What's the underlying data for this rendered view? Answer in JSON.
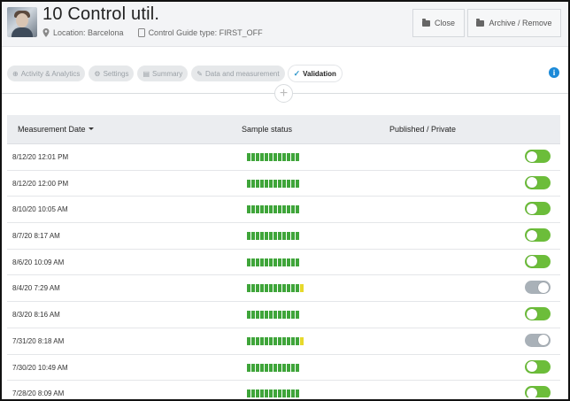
{
  "header": {
    "title": "10 Control util.",
    "location": "Location: Barcelona",
    "guide": "Control Guide type: FIRST_OFF",
    "close_label": "Close",
    "archive_label": "Archive / Remove"
  },
  "tabs": [
    {
      "label": "Activity & Analytics"
    },
    {
      "label": "Settings"
    },
    {
      "label": "Summary"
    },
    {
      "label": "Data and measurement"
    },
    {
      "label": "Validation",
      "active": true
    }
  ],
  "table": {
    "col_date": "Measurement Date",
    "col_status": "Sample status",
    "col_pub": "Published / Private",
    "rows": [
      {
        "date": "8/12/20 12:01 PM",
        "samples": [
          "g",
          "g",
          "g",
          "g",
          "g",
          "g",
          "g",
          "g",
          "g",
          "g",
          "g",
          "g"
        ],
        "published": true
      },
      {
        "date": "8/12/20 12:00 PM",
        "samples": [
          "g",
          "g",
          "g",
          "g",
          "g",
          "g",
          "g",
          "g",
          "g",
          "g",
          "g",
          "g"
        ],
        "published": true
      },
      {
        "date": "8/10/20 10:05 AM",
        "samples": [
          "g",
          "g",
          "g",
          "g",
          "g",
          "g",
          "g",
          "g",
          "g",
          "g",
          "g",
          "g"
        ],
        "published": true
      },
      {
        "date": "8/7/20 8:17 AM",
        "samples": [
          "g",
          "g",
          "g",
          "g",
          "g",
          "g",
          "g",
          "g",
          "g",
          "g",
          "g",
          "g"
        ],
        "published": true
      },
      {
        "date": "8/6/20 10:09 AM",
        "samples": [
          "g",
          "g",
          "g",
          "g",
          "g",
          "g",
          "g",
          "g",
          "g",
          "g",
          "g",
          "g"
        ],
        "published": true
      },
      {
        "date": "8/4/20 7:29 AM",
        "samples": [
          "g",
          "g",
          "g",
          "g",
          "g",
          "g",
          "g",
          "g",
          "g",
          "g",
          "g",
          "g",
          "y"
        ],
        "published": false
      },
      {
        "date": "8/3/20 8:16 AM",
        "samples": [
          "g",
          "g",
          "g",
          "g",
          "g",
          "g",
          "g",
          "g",
          "g",
          "g",
          "g",
          "g"
        ],
        "published": true
      },
      {
        "date": "7/31/20 8:18 AM",
        "samples": [
          "g",
          "g",
          "g",
          "g",
          "g",
          "g",
          "g",
          "g",
          "g",
          "g",
          "g",
          "g",
          "y"
        ],
        "published": false
      },
      {
        "date": "7/30/20 10:49 AM",
        "samples": [
          "g",
          "g",
          "g",
          "g",
          "g",
          "g",
          "g",
          "g",
          "g",
          "g",
          "g",
          "g"
        ],
        "published": true
      },
      {
        "date": "7/28/20 8:09 AM",
        "samples": [
          "g",
          "g",
          "g",
          "g",
          "g",
          "g",
          "g",
          "g",
          "g",
          "g",
          "g",
          "g"
        ],
        "published": true
      }
    ]
  },
  "colors": {
    "ok": "#3fa53a",
    "warn": "#e6d92b",
    "toggle_on": "#6cbd3a",
    "toggle_off": "#a9b1b8",
    "accent": "#1c8ad8"
  }
}
